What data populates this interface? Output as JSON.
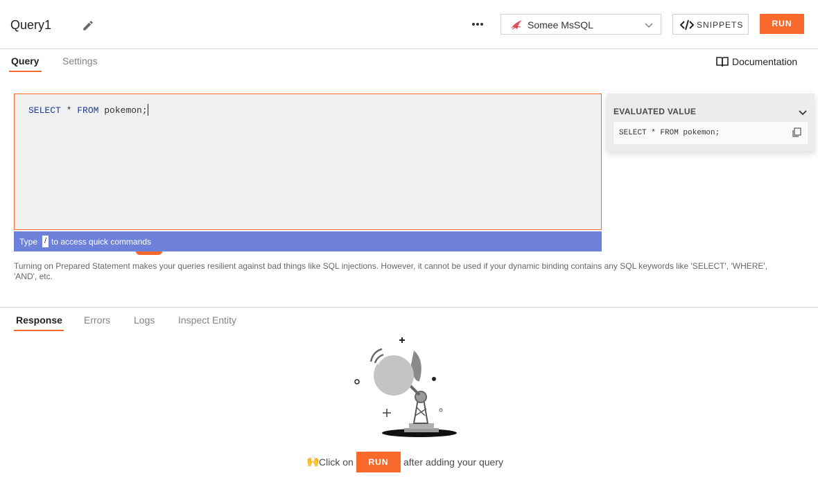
{
  "header": {
    "query_name": "Query1",
    "datasource": "Somee MsSQL",
    "snippets_label": "SNIPPETS",
    "run_label": "RUN"
  },
  "tabs": [
    {
      "label": "Query",
      "active": true
    },
    {
      "label": "Settings",
      "active": false
    }
  ],
  "documentation_label": "Documentation",
  "editor": {
    "kw_select": "SELECT",
    "star": " * ",
    "kw_from": "FROM",
    "rest": " pokemon;",
    "hint_prefix": "Type",
    "hint_key": "/",
    "hint_suffix": "to access quick commands"
  },
  "evaluated": {
    "title": "EVALUATED VALUE",
    "value": "SELECT * FROM pokemon;"
  },
  "prepared_note": "Turning on Prepared Statement makes your queries resilient against bad things like SQL injections. However, it cannot be used if your dynamic binding contains any SQL keywords like 'SELECT', 'WHERE', 'AND', etc.",
  "response_tabs": [
    {
      "label": "Response",
      "active": true
    },
    {
      "label": "Errors",
      "active": false
    },
    {
      "label": "Logs",
      "active": false
    },
    {
      "label": "Inspect Entity",
      "active": false
    }
  ],
  "cta": {
    "emoji": "🙌",
    "prefix": "Click on",
    "button": "RUN",
    "suffix": "after adding your query"
  },
  "colors": {
    "accent": "#f86a2b",
    "hint_bar": "#6d81d8",
    "editor_bg": "#f0f0f0"
  },
  "icons": [
    "pencil-icon",
    "more-dots-icon",
    "mssql-logo-icon",
    "chevron-down-icon",
    "code-icon",
    "book-icon",
    "copy-icon",
    "satellite-illustration"
  ]
}
